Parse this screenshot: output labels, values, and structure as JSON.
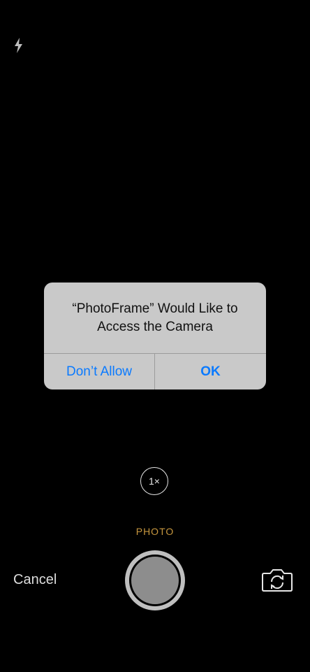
{
  "alert": {
    "title": "“PhotoFrame” Would Like to Access the Camera",
    "deny_label": "Don’t Allow",
    "ok_label": "OK"
  },
  "camera": {
    "zoom_label": "1×",
    "mode_label": "PHOTO",
    "cancel_label": "Cancel"
  },
  "colors": {
    "background": "#000000",
    "alert_background": "#c9c9c9",
    "button_blue": "#0a7aff",
    "mode_gold": "#c7973f"
  },
  "icons": {
    "flash": "flash-icon",
    "switch_camera": "switch-camera-icon"
  }
}
